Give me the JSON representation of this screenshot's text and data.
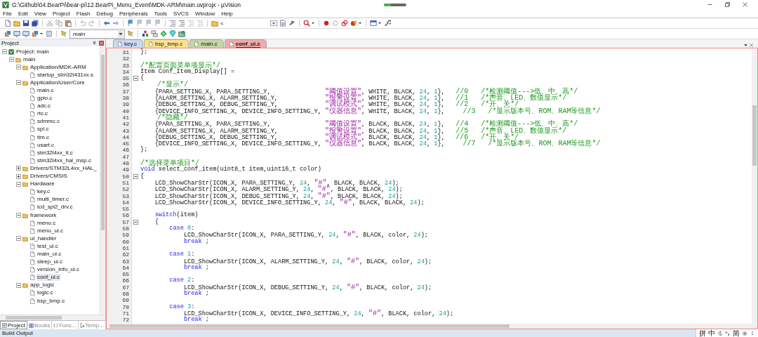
{
  "window": {
    "title": "G:\\Github\\04.BearPi\\bear-pi\\12.BearPi_Menu_Event\\MDK-ARM\\main.uvprojx - µVision",
    "progress": {
      "level": 0.3
    }
  },
  "menu": [
    "File",
    "Edit",
    "View",
    "Project",
    "Flash",
    "Debug",
    "Peripherals",
    "Tools",
    "SVCS",
    "Window",
    "Help"
  ],
  "toolbar": {
    "fragment": "<",
    "target": "main"
  },
  "sidebar": {
    "title": "Project",
    "tree": [
      {
        "label": "Project: main",
        "kind": "project",
        "expanded": true,
        "selected": false,
        "children": [
          {
            "label": "main",
            "kind": "target",
            "expanded": true,
            "selected": false,
            "children": [
              {
                "label": "Application/MDK-ARM",
                "kind": "folder",
                "expanded": true,
                "selected": false,
                "children": [
                  {
                    "label": "startup_stm32l431xx.s",
                    "kind": "file",
                    "selected": false
                  }
                ]
              },
              {
                "label": "Application/User/Core",
                "kind": "folder",
                "expanded": true,
                "selected": false,
                "children": [
                  {
                    "label": "main.c",
                    "kind": "file",
                    "selected": false
                  },
                  {
                    "label": "gpio.c",
                    "kind": "file",
                    "selected": false
                  },
                  {
                    "label": "adc.c",
                    "kind": "file",
                    "selected": false
                  },
                  {
                    "label": "rtc.c",
                    "kind": "file",
                    "selected": false
                  },
                  {
                    "label": "sdmmc.c",
                    "kind": "file",
                    "selected": false
                  },
                  {
                    "label": "spi.c",
                    "kind": "file",
                    "selected": false
                  },
                  {
                    "label": "tim.c",
                    "kind": "file",
                    "selected": false
                  },
                  {
                    "label": "usart.c",
                    "kind": "file",
                    "selected": false
                  },
                  {
                    "label": "stm32l4xx_it.c",
                    "kind": "file",
                    "selected": false
                  },
                  {
                    "label": "stm32l4xx_hal_msp.c",
                    "kind": "file",
                    "selected": false
                  }
                ]
              },
              {
                "label": "Drivers/STM32L4xx_HAL_",
                "kind": "folder",
                "expanded": false,
                "selected": false
              },
              {
                "label": "Drivers/CMSIS",
                "kind": "folder",
                "expanded": false,
                "selected": false
              },
              {
                "label": "Hardware",
                "kind": "folder",
                "expanded": true,
                "selected": false,
                "children": [
                  {
                    "label": "key.c",
                    "kind": "file",
                    "selected": false
                  },
                  {
                    "label": "multi_timer.c",
                    "kind": "file",
                    "selected": false
                  },
                  {
                    "label": "lcd_spi2_drv.c",
                    "kind": "file",
                    "selected": false
                  }
                ]
              },
              {
                "label": "framework",
                "kind": "folder",
                "expanded": true,
                "selected": false,
                "children": [
                  {
                    "label": "menu.c",
                    "kind": "file",
                    "selected": false
                  },
                  {
                    "label": "menu_ui.c",
                    "kind": "file",
                    "selected": false
                  }
                ]
              },
              {
                "label": "ui_handler",
                "kind": "folder",
                "expanded": true,
                "selected": false,
                "children": [
                  {
                    "label": "test_ui.c",
                    "kind": "file",
                    "selected": false
                  },
                  {
                    "label": "main_ui.c",
                    "kind": "file",
                    "selected": false
                  },
                  {
                    "label": "sleep_ui.c",
                    "kind": "file",
                    "selected": false
                  },
                  {
                    "label": "version_info_ui.c",
                    "kind": "file",
                    "selected": false
                  },
                  {
                    "label": "conf_ui.c",
                    "kind": "file",
                    "selected": true
                  }
                ]
              },
              {
                "label": "app_logic",
                "kind": "folder",
                "expanded": true,
                "selected": false,
                "children": [
                  {
                    "label": "logic.c",
                    "kind": "file",
                    "selected": false
                  },
                  {
                    "label": "bsp_bmp.c",
                    "kind": "file",
                    "selected": false
                  }
                ]
              }
            ]
          }
        ]
      }
    ],
    "bottom_tabs": [
      {
        "label": "Project",
        "selected": true
      },
      {
        "label": "Books",
        "selected": false
      },
      {
        "label": "Func...",
        "selected": false
      },
      {
        "label": "Temp...",
        "selected": false
      }
    ]
  },
  "tabs": [
    {
      "label": "key.c",
      "color": "#c9d9f2",
      "selected": false
    },
    {
      "label": "bsp_bmp.c",
      "color": "#fbe38a",
      "selected": false
    },
    {
      "label": "main.c",
      "color": "#c9d3a6",
      "selected": false
    },
    {
      "label": "conf_ui.c",
      "color": "#f2a9a9",
      "selected": true
    }
  ],
  "code": [
    {
      "n": "31",
      "fold": false,
      "t": [
        {
          "kind": "plain",
          "text": "};"
        }
      ]
    },
    {
      "n": "32",
      "fold": false
    },
    {
      "n": "33",
      "fold": false,
      "t": [
        {
          "kind": "comment",
          "text": "/*配置页面菜单项显示*/"
        }
      ]
    },
    {
      "n": "34",
      "fold": false,
      "t": [
        {
          "kind": "plain",
          "text": "Item Conf_Item_Display[] ="
        }
      ]
    },
    {
      "n": "35",
      "fold": true,
      "t": [
        {
          "kind": "plain",
          "text": "{"
        }
      ]
    },
    {
      "n": "36",
      "fold": false,
      "t": [
        {
          "kind": "comment",
          "text": "    /*显示*/"
        }
      ]
    },
    {
      "n": "37",
      "fold": false,
      "t": [
        {
          "kind": "plain",
          "text": "    {PARA_SETTING_X, PARA_SETTING_Y,               "
        },
        {
          "kind": "string",
          "text": "\"阈值设置\""
        },
        {
          "kind": "plain",
          "text": ", WHITE, BLACK, "
        },
        {
          "kind": "number",
          "text": "24"
        },
        {
          "kind": "plain",
          "text": ", "
        },
        {
          "kind": "number",
          "text": "1"
        },
        {
          "kind": "plain",
          "text": "},   "
        },
        {
          "kind": "comment",
          "text": "//0   /*检测阈值--->低、中、高*/"
        }
      ]
    },
    {
      "n": "38",
      "fold": false,
      "t": [
        {
          "kind": "plain",
          "text": "    {ALARM_SETTING_X, ALARM_SETTING_Y,             "
        },
        {
          "kind": "string",
          "text": "\"报警设置\""
        },
        {
          "kind": "plain",
          "text": ", WHITE, BLACK, "
        },
        {
          "kind": "number",
          "text": "24"
        },
        {
          "kind": "plain",
          "text": ", "
        },
        {
          "kind": "number",
          "text": "1"
        },
        {
          "kind": "plain",
          "text": "},   "
        },
        {
          "kind": "comment",
          "text": "//1   /*声音、LED、数值显示*/"
        }
      ]
    },
    {
      "n": "39",
      "fold": false,
      "t": [
        {
          "kind": "plain",
          "text": "    {DEBUG_SETTING_X, DEBUG_SETTING_Y,             "
        },
        {
          "kind": "string",
          "text": "\"调试模式\""
        },
        {
          "kind": "plain",
          "text": ", WHITE, BLACK, "
        },
        {
          "kind": "number",
          "text": "24"
        },
        {
          "kind": "plain",
          "text": ", "
        },
        {
          "kind": "number",
          "text": "1"
        },
        {
          "kind": "plain",
          "text": "},   "
        },
        {
          "kind": "comment",
          "text": "//2   /*开、关*/"
        }
      ]
    },
    {
      "n": "40",
      "fold": false,
      "t": [
        {
          "kind": "plain",
          "text": "    {DEVICE_INFO_SETTING_X, DEVICE_INFO_SETTING_Y, "
        },
        {
          "kind": "string",
          "text": "\"仪器信息\""
        },
        {
          "kind": "plain",
          "text": ", WHITE, BLACK, "
        },
        {
          "kind": "number",
          "text": "24"
        },
        {
          "kind": "plain",
          "text": ", "
        },
        {
          "kind": "number",
          "text": "1"
        },
        {
          "kind": "plain",
          "text": "},     "
        },
        {
          "kind": "comment",
          "text": "//3   /*显示版本号、ROM、RAM等信息*/"
        }
      ]
    },
    {
      "n": "41",
      "fold": false,
      "t": [
        {
          "kind": "comment",
          "text": "    /*隐藏*/"
        }
      ]
    },
    {
      "n": "42",
      "fold": false,
      "t": [
        {
          "kind": "plain",
          "text": "    {PARA_SETTING_X, PARA_SETTING_Y,               "
        },
        {
          "kind": "string",
          "text": "\"阈值设置\""
        },
        {
          "kind": "plain",
          "text": ", BLACK, BLACK, "
        },
        {
          "kind": "number",
          "text": "24"
        },
        {
          "kind": "plain",
          "text": ", "
        },
        {
          "kind": "number",
          "text": "1"
        },
        {
          "kind": "plain",
          "text": "},   "
        },
        {
          "kind": "comment",
          "text": "//4   /*检测阈值--->低、中、高*/"
        }
      ]
    },
    {
      "n": "43",
      "fold": false,
      "t": [
        {
          "kind": "plain",
          "text": "    {ALARM_SETTING_X, ALARM_SETTING_Y,             "
        },
        {
          "kind": "string",
          "text": "\"报警设置\""
        },
        {
          "kind": "plain",
          "text": ", BLACK, BLACK, "
        },
        {
          "kind": "number",
          "text": "24"
        },
        {
          "kind": "plain",
          "text": ", "
        },
        {
          "kind": "number",
          "text": "1"
        },
        {
          "kind": "plain",
          "text": "},   "
        },
        {
          "kind": "comment",
          "text": "//5   /*声音、LED、数值显示*/"
        }
      ]
    },
    {
      "n": "44",
      "fold": false,
      "t": [
        {
          "kind": "plain",
          "text": "    {DEBUG_SETTING_X, DEBUG_SETTING_Y,             "
        },
        {
          "kind": "string",
          "text": "\"调试模式\""
        },
        {
          "kind": "plain",
          "text": ", BLACK, BLACK, "
        },
        {
          "kind": "number",
          "text": "24"
        },
        {
          "kind": "plain",
          "text": ", "
        },
        {
          "kind": "number",
          "text": "1"
        },
        {
          "kind": "plain",
          "text": "},   "
        },
        {
          "kind": "comment",
          "text": "//6   /*开、关*/"
        }
      ]
    },
    {
      "n": "45",
      "fold": false,
      "t": [
        {
          "kind": "plain",
          "text": "    {DEVICE_INFO_SETTING_X, DEVICE_INFO_SETTING_Y, "
        },
        {
          "kind": "string",
          "text": "\"仪器信息\""
        },
        {
          "kind": "plain",
          "text": ", BLACK, BLACK, "
        },
        {
          "kind": "number",
          "text": "24"
        },
        {
          "kind": "plain",
          "text": ", "
        },
        {
          "kind": "number",
          "text": "1"
        },
        {
          "kind": "plain",
          "text": "},     "
        },
        {
          "kind": "comment",
          "text": "//7   /*显示版本号、ROM、RAM等信息*/"
        }
      ]
    },
    {
      "n": "46",
      "fold": false,
      "t": [
        {
          "kind": "plain",
          "text": "};"
        }
      ]
    },
    {
      "n": "47",
      "fold": false
    },
    {
      "n": "48",
      "fold": false,
      "t": [
        {
          "kind": "comment",
          "text": "/*选择菜单项目*/"
        }
      ]
    },
    {
      "n": "49",
      "fold": false,
      "t": [
        {
          "kind": "keyword",
          "text": "void"
        },
        {
          "kind": "plain",
          "text": " select_conf_item(uint8_t item,uint16_t color)"
        }
      ]
    },
    {
      "n": "50",
      "fold": true,
      "t": [
        {
          "kind": "plain",
          "text": "{"
        }
      ]
    },
    {
      "n": "51",
      "fold": false,
      "t": [
        {
          "kind": "plain",
          "text": "    LCD_ShowCharStr(ICON_X, PARA_SETTING_Y, "
        },
        {
          "kind": "number",
          "text": "24"
        },
        {
          "kind": "plain",
          "text": ", "
        },
        {
          "kind": "string",
          "text": "\"#\""
        },
        {
          "kind": "plain",
          "text": ", BLACK, BLACK, "
        },
        {
          "kind": "number",
          "text": "24"
        },
        {
          "kind": "plain",
          "text": ");"
        }
      ]
    },
    {
      "n": "52",
      "fold": false,
      "t": [
        {
          "kind": "plain",
          "text": "    LCD_ShowCharStr(ICON_X, ALARM_SETTING_Y, "
        },
        {
          "kind": "number",
          "text": "24"
        },
        {
          "kind": "plain",
          "text": ", "
        },
        {
          "kind": "string",
          "text": "\"#\""
        },
        {
          "kind": "plain",
          "text": ", BLACK, BLACK, "
        },
        {
          "kind": "number",
          "text": "24"
        },
        {
          "kind": "plain",
          "text": ");"
        }
      ]
    },
    {
      "n": "53",
      "fold": false,
      "t": [
        {
          "kind": "plain",
          "text": "    LCD_ShowCharStr(ICON_X, DEBUG_SETTING_Y, "
        },
        {
          "kind": "number",
          "text": "24"
        },
        {
          "kind": "plain",
          "text": ", "
        },
        {
          "kind": "string",
          "text": "\"#\""
        },
        {
          "kind": "plain",
          "text": ", BLACK, BLACK, "
        },
        {
          "kind": "number",
          "text": "24"
        },
        {
          "kind": "plain",
          "text": ");"
        }
      ]
    },
    {
      "n": "54",
      "fold": false,
      "t": [
        {
          "kind": "plain",
          "text": "    LCD_ShowCharStr(ICON_X, DEVICE_INFO_SETTING_Y, "
        },
        {
          "kind": "number",
          "text": "24"
        },
        {
          "kind": "plain",
          "text": ", "
        },
        {
          "kind": "string",
          "text": "\"#\""
        },
        {
          "kind": "plain",
          "text": ", BLACK, BLACK, "
        },
        {
          "kind": "number",
          "text": "24"
        },
        {
          "kind": "plain",
          "text": ");"
        }
      ]
    },
    {
      "n": "55",
      "fold": false
    },
    {
      "n": "56",
      "fold": false,
      "t": [
        {
          "kind": "keyword",
          "text": "    switch"
        },
        {
          "kind": "plain",
          "text": "(item)"
        }
      ]
    },
    {
      "n": "57",
      "fold": true,
      "t": [
        {
          "kind": "plain",
          "text": "    {"
        }
      ]
    },
    {
      "n": "58",
      "fold": false,
      "t": [
        {
          "kind": "keyword",
          "text": "        case"
        },
        {
          "kind": "number",
          "text": " 0"
        },
        {
          "kind": "plain",
          "text": ":"
        }
      ]
    },
    {
      "n": "59",
      "fold": false,
      "t": [
        {
          "kind": "plain",
          "text": "            LCD_ShowCharStr(ICON_X, PARA_SETTING_Y, "
        },
        {
          "kind": "number",
          "text": "24"
        },
        {
          "kind": "plain",
          "text": ", "
        },
        {
          "kind": "string",
          "text": "\"#\""
        },
        {
          "kind": "plain",
          "text": ", BLACK, color, "
        },
        {
          "kind": "number",
          "text": "24"
        },
        {
          "kind": "plain",
          "text": ");"
        }
      ]
    },
    {
      "n": "60",
      "fold": false,
      "t": [
        {
          "kind": "keyword",
          "text": "            break"
        },
        {
          "kind": "plain",
          "text": " ;"
        }
      ]
    },
    {
      "n": "61",
      "fold": false
    },
    {
      "n": "62",
      "fold": false,
      "t": [
        {
          "kind": "keyword",
          "text": "        case"
        },
        {
          "kind": "number",
          "text": " 1"
        },
        {
          "kind": "plain",
          "text": ":"
        }
      ]
    },
    {
      "n": "63",
      "fold": false,
      "t": [
        {
          "kind": "plain",
          "text": "            LCD_ShowCharStr(ICON_X, ALARM_SETTING_Y, "
        },
        {
          "kind": "number",
          "text": "24"
        },
        {
          "kind": "plain",
          "text": ", "
        },
        {
          "kind": "string",
          "text": "\"#\""
        },
        {
          "kind": "plain",
          "text": ", BLACK, color, "
        },
        {
          "kind": "number",
          "text": "24"
        },
        {
          "kind": "plain",
          "text": ");"
        }
      ]
    },
    {
      "n": "64",
      "fold": false,
      "t": [
        {
          "kind": "keyword",
          "text": "            break"
        },
        {
          "kind": "plain",
          "text": " ;"
        }
      ]
    },
    {
      "n": "65",
      "fold": false
    },
    {
      "n": "66",
      "fold": false,
      "t": [
        {
          "kind": "keyword",
          "text": "        case"
        },
        {
          "kind": "number",
          "text": " 2"
        },
        {
          "kind": "plain",
          "text": ":"
        }
      ]
    },
    {
      "n": "67",
      "fold": false,
      "t": [
        {
          "kind": "plain",
          "text": "            LCD_ShowCharStr(ICON_X, DEBUG_SETTING_Y, "
        },
        {
          "kind": "number",
          "text": "24"
        },
        {
          "kind": "plain",
          "text": ", "
        },
        {
          "kind": "string",
          "text": "\"#\""
        },
        {
          "kind": "plain",
          "text": ", BLACK, color, "
        },
        {
          "kind": "number",
          "text": "24"
        },
        {
          "kind": "plain",
          "text": ");"
        }
      ]
    },
    {
      "n": "68",
      "fold": false,
      "t": [
        {
          "kind": "keyword",
          "text": "            break"
        },
        {
          "kind": "plain",
          "text": " ;"
        }
      ]
    },
    {
      "n": "69",
      "fold": false
    },
    {
      "n": "70",
      "fold": false,
      "t": [
        {
          "kind": "keyword",
          "text": "        case"
        },
        {
          "kind": "number",
          "text": " 3"
        },
        {
          "kind": "plain",
          "text": ":"
        }
      ]
    },
    {
      "n": "71",
      "fold": false,
      "t": [
        {
          "kind": "plain",
          "text": "            LCD_ShowCharStr(ICON_X, DEVICE_INFO_SETTING_Y, "
        },
        {
          "kind": "number",
          "text": "24"
        },
        {
          "kind": "plain",
          "text": ", "
        },
        {
          "kind": "string",
          "text": "\"#\""
        },
        {
          "kind": "plain",
          "text": ", BLACK, color, "
        },
        {
          "kind": "number",
          "text": "24"
        },
        {
          "kind": "plain",
          "text": ");"
        }
      ]
    },
    {
      "n": "72",
      "fold": false,
      "t": [
        {
          "kind": "keyword",
          "text": "            break"
        },
        {
          "kind": "plain",
          "text": " ;"
        }
      ]
    }
  ],
  "status_bar": {
    "label": "Build Output",
    "ime": [
      "拼",
      "中",
      "简"
    ]
  }
}
